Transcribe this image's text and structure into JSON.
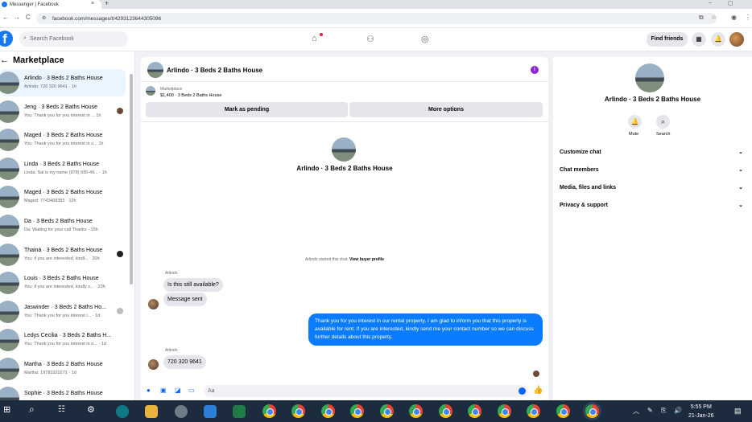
{
  "browser": {
    "tab_title": "Messenger | Facebook",
    "tab_close": "×",
    "new_tab": "+",
    "url": "facebook.com/messages/t/4293123644305096",
    "win_min": "–",
    "win_max": "▢",
    "back": "←",
    "forward": "→",
    "reload": "C"
  },
  "header": {
    "logo": "f",
    "search_placeholder": "Search Facebook",
    "find_friends": "Find friends"
  },
  "sidebar": {
    "title": "Marketplace",
    "back": "←",
    "conversations": [
      {
        "name": "Arlindo · 3 Beds 2 Baths House",
        "preview": "Arlindo: 720 320 9641 · 1h",
        "active": true,
        "badge": "none"
      },
      {
        "name": "Jeng · 3 Beds 2 Baths House",
        "preview": "You: Thank you for you interest in ...  1h",
        "active": false,
        "badge": "brown"
      },
      {
        "name": "Maged · 3 Beds 2 Baths House",
        "preview": "You: Thank you for you interest in o...  1h",
        "active": false,
        "badge": "none"
      },
      {
        "name": "Linda · 3 Beds 2 Baths House",
        "preview": "Linda: Sal is my name (978) 930-49... · 1h",
        "active": false,
        "badge": "none"
      },
      {
        "name": "Maged · 3 Beds 2 Baths House",
        "preview": "Maged: 7743408383 · 12h",
        "active": false,
        "badge": "none"
      },
      {
        "name": "Da · 3 Beds 2 Baths House",
        "preview": "Da: Waiting for your call Thanks · 15h",
        "active": false,
        "badge": "none"
      },
      {
        "name": "Thainá · 3 Beds 2 Baths House",
        "preview": "You: if you are interested, kindl... · 20h",
        "active": false,
        "badge": "dark"
      },
      {
        "name": "Louis · 3 Beds 2 Baths House",
        "preview": "You: if you are interested, kindly s... · 23h",
        "active": false,
        "badge": "none"
      },
      {
        "name": "Jaswinder · 3 Beds 2 Baths Ho...",
        "preview": "You: Thank you for you interest i... · 1d",
        "active": false,
        "badge": "gray"
      },
      {
        "name": "Ledys Cecilia · 3 Beds 2 Baths H...",
        "preview": "You: Thank you for you interest in o... · 1d",
        "active": false,
        "badge": "none"
      },
      {
        "name": "Martha · 3 Beds 2 Baths House",
        "preview": "Martha: 19783320271 · 1d",
        "active": false,
        "badge": "none"
      },
      {
        "name": "Sophie · 3 Beds 2 Baths House",
        "preview": "",
        "active": false,
        "badge": "none"
      }
    ]
  },
  "chat": {
    "title": "Arlindo · 3 Beds 2 Baths House",
    "marketplace_label": "Marketplace",
    "listing": "$1,400 · 3 Beds 2 Baths House",
    "mark_pending": "Mark as pending",
    "more_options": "More options",
    "profile_name": "Arlindo · 3 Beds 2 Baths House",
    "started_text": "Arlindo started this chat. ",
    "view_buyer": "View buyer profile",
    "sender": "Arlindo",
    "msg1": "Is this still available?",
    "msg2": "Message sent",
    "out_msg": "Thank you for you interest in our rental property. I am glad to inform you that this property is available for rent. If you are interested, kindly send me your contact number so we can discuss further details about this property.",
    "sender2": "Arlindo",
    "msg3": "720 320 9641",
    "composer_placeholder": "Aa"
  },
  "right_panel": {
    "name": "Arlindo · 3 Beds 2 Baths House",
    "mute": "Mute",
    "search": "Search",
    "rows": [
      "Customize chat",
      "Chat members",
      "Media, files and links",
      "Privacy & support"
    ]
  },
  "taskbar": {
    "time": "5:55 PM",
    "date": "21-Jan-26"
  },
  "colors": {
    "accent": "#0866ff",
    "brand": "#1877f2",
    "out_bubble": "#0a7cff",
    "taskbar": "#1c2b3d"
  }
}
